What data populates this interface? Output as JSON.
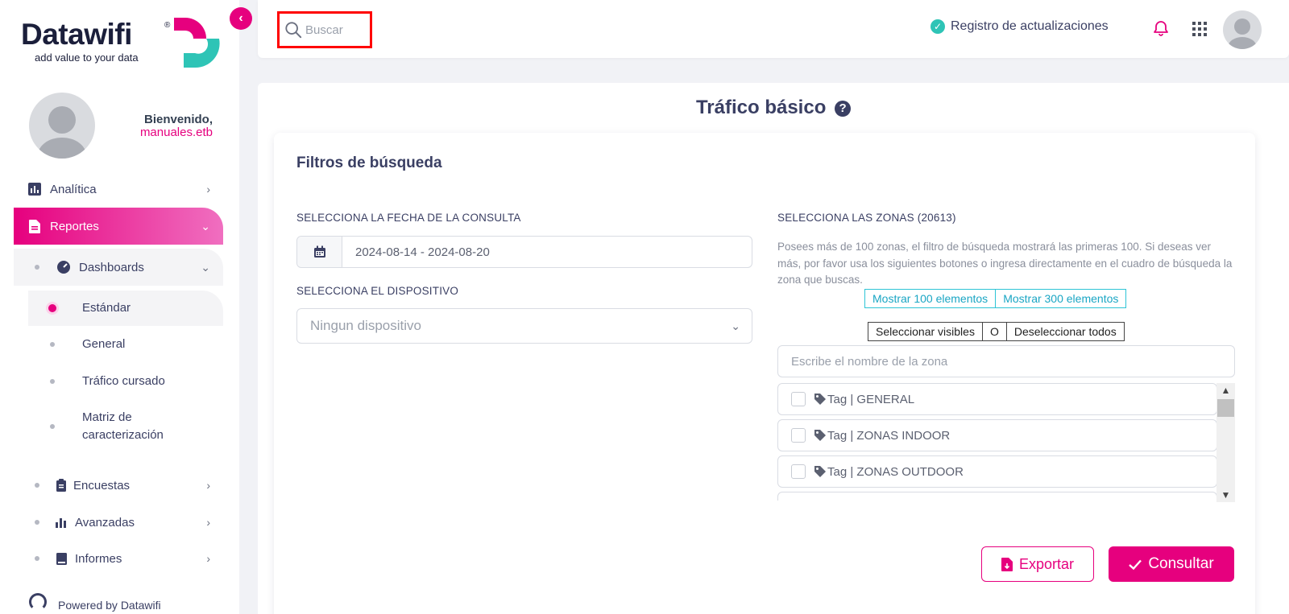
{
  "brand": {
    "name": "Datawifi",
    "registered": "®",
    "tagline": "add value to your data",
    "primary_color": "#e6007e",
    "accent_color": "#2ec4b6"
  },
  "sidebar": {
    "welcome": "Bienvenido,",
    "username": "manuales.etb",
    "items": [
      {
        "label": "Analítica",
        "icon": "bar-chart-square-icon"
      },
      {
        "label": "Reportes",
        "icon": "document-icon",
        "active": true
      },
      {
        "label": "Dashboards",
        "icon": "gauge-icon",
        "expanded": true
      },
      {
        "label": "Estándar",
        "active": true
      },
      {
        "label": "General"
      },
      {
        "label": "Tráfico cursado"
      },
      {
        "label": "Matriz de caracterización"
      },
      {
        "label": "Encuestas",
        "icon": "clipboard-icon"
      },
      {
        "label": "Avanzadas",
        "icon": "bar-chart-icon"
      },
      {
        "label": "Informes",
        "icon": "book-icon"
      }
    ],
    "matriz_line1": "Matriz de",
    "matriz_line2": "caracterización",
    "powered": "Powered by Datawifi"
  },
  "topbar": {
    "search_placeholder": "Buscar",
    "updates_label": "Registro de actualizaciones"
  },
  "main": {
    "title": "Tráfico básico",
    "help": "?",
    "filters_title": "Filtros de búsqueda",
    "date_label": "SELECCIONA LA FECHA DE LA CONSULTA",
    "date_value": "2024-08-14 - 2024-08-20",
    "device_label": "SELECCIONA EL DISPOSITIVO",
    "device_placeholder": "Ningun dispositivo",
    "zones_label": "SELECCIONA LAS ZONAS (20613)",
    "zones_description": "Posees más de 100 zonas, el filtro de búsqueda mostrará las primeras 100. Si deseas ver más, por favor usa los siguientes botones o ingresa directamente en el cuadro de búsqueda la zona que buscas.",
    "show_100": "Mostrar 100 elementos",
    "show_300": "Mostrar 300 elementos",
    "select_visible": "Seleccionar visibles",
    "or": "O",
    "deselect_all": "Deseleccionar todos",
    "zone_search_placeholder": "Escribe el nombre de la zona",
    "zones": [
      {
        "label": "Tag | GENERAL"
      },
      {
        "label": "Tag | ZONAS INDOOR"
      },
      {
        "label": "Tag | ZONAS OUTDOOR"
      }
    ],
    "export_label": "Exportar",
    "consult_label": "Consultar"
  }
}
